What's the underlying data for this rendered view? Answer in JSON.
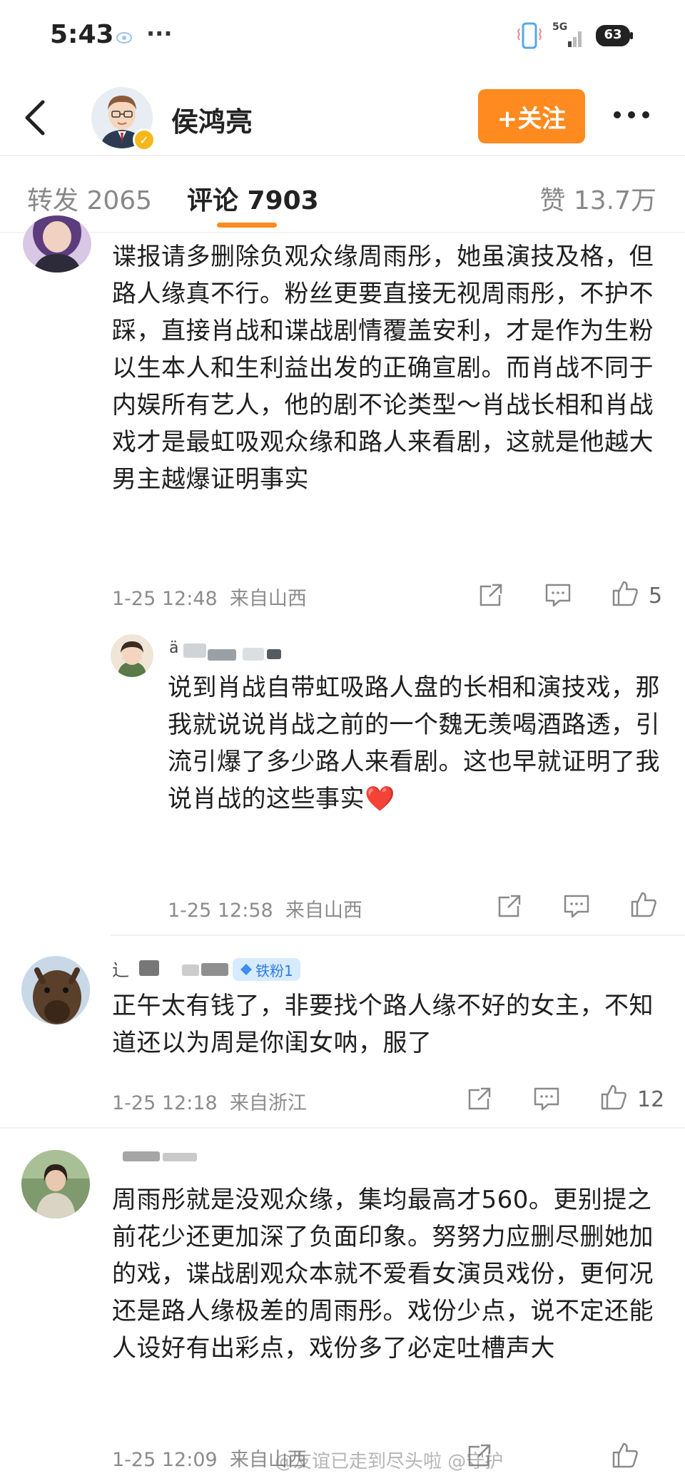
{
  "status_bar": {
    "time": "5:43",
    "menu": "···",
    "network": "5G",
    "battery": "63"
  },
  "header": {
    "user_name": "侯鸿亮",
    "follow_label": "+关注"
  },
  "tabs": [
    {
      "label": "转发 2065"
    },
    {
      "label": "评论 7903"
    },
    {
      "label": "赞 13.7万"
    }
  ],
  "comments": [
    {
      "text": "谍报请多删除负观众缘周雨彤，她虽演技及格，但路人缘真不行。粉丝更要直接无视周雨彤，不护不踩，直接肖战和谍战剧情覆盖安利，才是作为生粉以生本人和生利益出发的正确宣剧。而肖战不同于内娱所有艺人，他的剧不论类型～肖战长相和肖战戏才是最虹吸观众缘和路人来看剧，这就是他越大男主越爆证明事实",
      "time": "1-25 12:48",
      "location": "来自山西",
      "likes": "5"
    },
    {
      "username_prefix": "ä",
      "text": "说到肖战自带虹吸路人盘的长相和演技戏，那我就说说肖战之前的一个魏无羡喝酒路透，引流引爆了多少路人来看剧。这也早就证明了我说肖战的这些事实❤️",
      "time": "1-25 12:58",
      "location": "来自山西",
      "likes": ""
    },
    {
      "username_prefix": "辶",
      "badge": "铁粉1",
      "text": "正午太有钱了，非要找个路人缘不好的女主，不知道还以为周是你闺女呐，服了",
      "time": "1-25 12:18",
      "location": "来自浙江",
      "likes": "12"
    },
    {
      "text": "周雨彤就是没观众缘，集均最高才560。更别提之前花少还更加深了负面印象。努努力应删尽删她加的戏，谍战剧观众本就不爱看女演员戏份，更何况还是路人缘极差的周雨彤。戏份少点，说不定还能人设好有出彩点，戏份多了必定吐槽声大",
      "time": "1-25 12:09",
      "location": "来自山西",
      "likes": ""
    }
  ],
  "watermark": "@友谊已走到尽头啦 @守护"
}
